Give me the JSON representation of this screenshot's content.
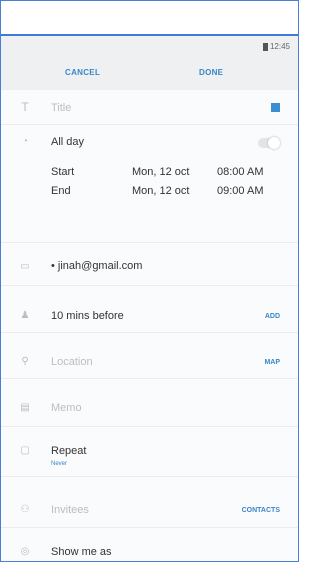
{
  "status": {
    "time": "12:45"
  },
  "header": {
    "cancel_label": "CANCEL",
    "done_label": "DONE"
  },
  "title": {
    "placeholder": "Title",
    "color": "#3a8fd3"
  },
  "all_day": {
    "label": "All day",
    "enabled": false
  },
  "start": {
    "label": "Start",
    "date": "Mon, 12 oct",
    "time": "08:00 AM"
  },
  "end": {
    "label": "End",
    "date": "Mon, 12 oct",
    "time": "09:00 AM"
  },
  "calendar": {
    "account": "• jinah@gmail.com"
  },
  "reminder": {
    "value": "10 mins before",
    "action": "ADD"
  },
  "location": {
    "placeholder": "Location",
    "action": "MAP"
  },
  "memo": {
    "placeholder": "Memo"
  },
  "repeat": {
    "label": "Repeat",
    "value": "Never"
  },
  "invitees": {
    "placeholder": "Invitees",
    "action": "CONTACTS"
  },
  "show_me_as": {
    "label": "Show me as"
  }
}
